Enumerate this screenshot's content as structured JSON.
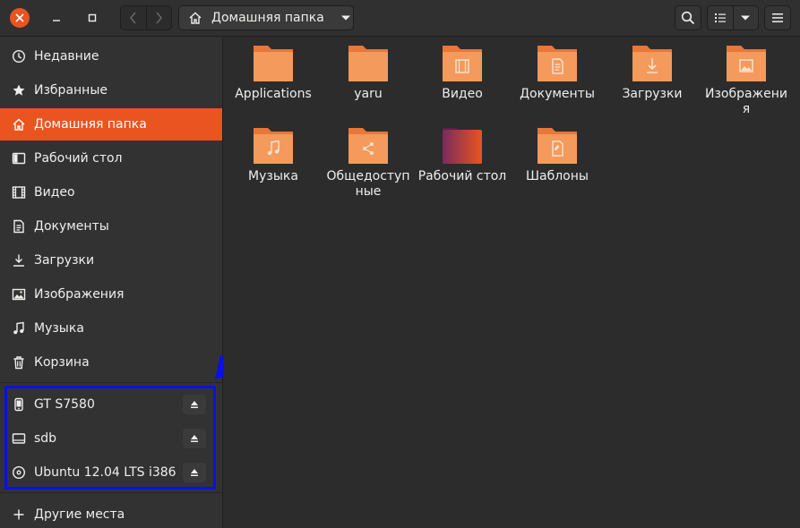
{
  "header": {
    "path_label": "Домашняя папка"
  },
  "sidebar": {
    "places": [
      {
        "label": "Недавние",
        "icon": "clock-icon"
      },
      {
        "label": "Избранные",
        "icon": "star-icon"
      },
      {
        "label": "Домашняя папка",
        "icon": "home-icon",
        "active": true
      },
      {
        "label": "Рабочий стол",
        "icon": "desktop-icon"
      },
      {
        "label": "Видео",
        "icon": "film-icon"
      },
      {
        "label": "Документы",
        "icon": "document-icon"
      },
      {
        "label": "Загрузки",
        "icon": "download-icon"
      },
      {
        "label": "Изображения",
        "icon": "image-icon"
      },
      {
        "label": "Музыка",
        "icon": "music-icon"
      },
      {
        "label": "Корзина",
        "icon": "trash-icon"
      }
    ],
    "devices": [
      {
        "label": "GT S7580",
        "icon": "phone-icon"
      },
      {
        "label": "sdb",
        "icon": "drive-icon"
      },
      {
        "label": "Ubuntu 12.04 LTS i386",
        "icon": "disc-icon"
      }
    ],
    "other_places": "Другие места"
  },
  "files": [
    {
      "name": "Applications",
      "emblem": "none"
    },
    {
      "name": "yaru",
      "emblem": "none"
    },
    {
      "name": "Видео",
      "emblem": "film"
    },
    {
      "name": "Документы",
      "emblem": "document"
    },
    {
      "name": "Загрузки",
      "emblem": "download"
    },
    {
      "name": "Изображения",
      "emblem": "image"
    },
    {
      "name": "Музыка",
      "emblem": "music"
    },
    {
      "name": "Общедоступные",
      "emblem": "share"
    },
    {
      "name": "Рабочий стол",
      "emblem": "desktop"
    },
    {
      "name": "Шаблоны",
      "emblem": "template"
    }
  ],
  "colors": {
    "accent": "#e95420",
    "folder": "#f39a5c",
    "highlight": "#0a10e6"
  }
}
